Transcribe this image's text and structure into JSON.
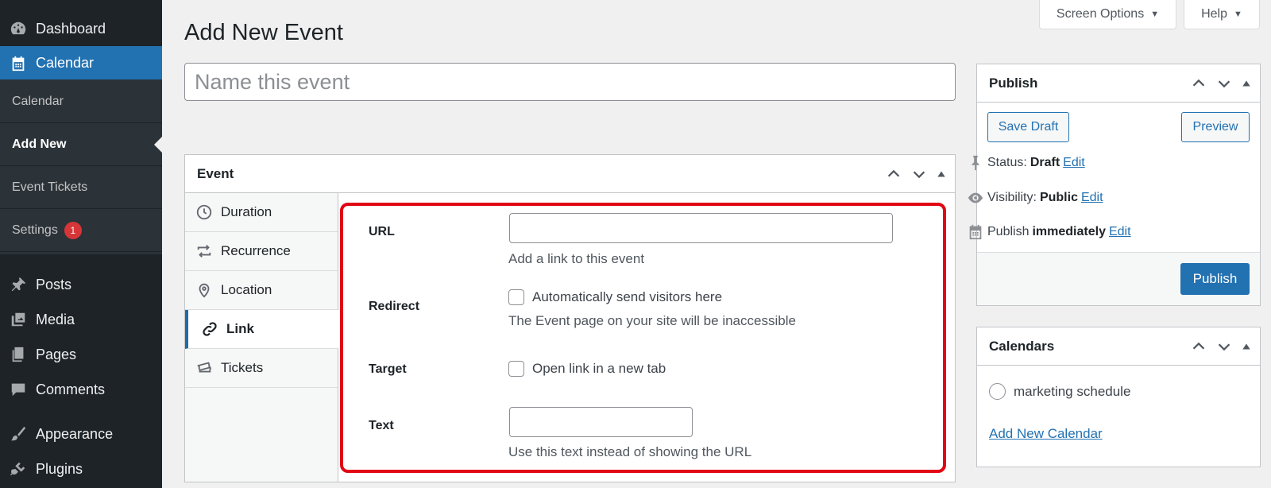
{
  "sidebar": {
    "items": [
      {
        "label": "Dashboard",
        "icon": "dashboard-icon"
      },
      {
        "label": "Calendar",
        "icon": "calendar-icon"
      },
      {
        "label": "Posts",
        "icon": "pin-icon"
      },
      {
        "label": "Media",
        "icon": "media-icon"
      },
      {
        "label": "Pages",
        "icon": "pages-icon"
      },
      {
        "label": "Comments",
        "icon": "comment-icon"
      },
      {
        "label": "Appearance",
        "icon": "brush-icon"
      },
      {
        "label": "Plugins",
        "icon": "plugin-icon"
      }
    ],
    "submenu": [
      {
        "label": "Calendar"
      },
      {
        "label": "Add New"
      },
      {
        "label": "Event Tickets"
      },
      {
        "label": "Settings",
        "badge": "1"
      }
    ]
  },
  "top": {
    "screen_options": "Screen Options",
    "help": "Help"
  },
  "page": {
    "title": "Add New Event",
    "name_placeholder": "Name this event"
  },
  "event_box": {
    "title": "Event",
    "tabs": [
      {
        "label": "Duration",
        "icon": "clock-icon"
      },
      {
        "label": "Recurrence",
        "icon": "repeat-icon"
      },
      {
        "label": "Location",
        "icon": "location-pin-icon"
      },
      {
        "label": "Link",
        "icon": "link-icon"
      },
      {
        "label": "Tickets",
        "icon": "tickets-icon"
      }
    ],
    "fields": {
      "url_label": "URL",
      "url_value": "",
      "url_help": "Add a link to this event",
      "redirect_label": "Redirect",
      "redirect_checkbox": "Automatically send visitors here",
      "redirect_help": "The Event page on your site will be inaccessible",
      "target_label": "Target",
      "target_checkbox": "Open link in a new tab",
      "text_label": "Text",
      "text_value": "",
      "text_help": "Use this text instead of showing the URL"
    }
  },
  "publish": {
    "title": "Publish",
    "save_draft": "Save Draft",
    "preview": "Preview",
    "status_label": "Status:",
    "status_value": "Draft",
    "visibility_label": "Visibility:",
    "visibility_value": "Public",
    "schedule_label": "Publish",
    "schedule_value": "immediately",
    "edit": "Edit",
    "publish_button": "Publish"
  },
  "calendars": {
    "title": "Calendars",
    "option": "marketing schedule",
    "add_link": "Add New Calendar"
  }
}
